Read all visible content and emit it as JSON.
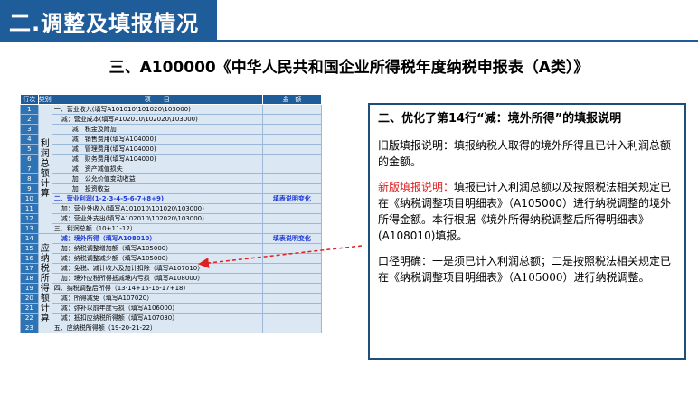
{
  "header": {
    "title": "二.调整及填报情况"
  },
  "main_title": "三、A100000《中华人民共和国企业所得税年度纳税申报表（A类）》",
  "table": {
    "headers": {
      "row": "行次",
      "category": "类别",
      "item": "项　　目",
      "amount": "金　额"
    },
    "category_profit": "利润总额计算",
    "category_taxable": "应纳税所得额计算",
    "rows": [
      {
        "num": "1",
        "item": "一、营业收入(填写A101010\\101020\\103000)",
        "amount": ""
      },
      {
        "num": "2",
        "item": "减：营业成本(填写A102010\\102020\\103000)",
        "amount": ""
      },
      {
        "num": "3",
        "item": "减：税金及附加",
        "amount": ""
      },
      {
        "num": "4",
        "item": "减：销售费用(填写A104000)",
        "amount": ""
      },
      {
        "num": "5",
        "item": "减：管理费用(填写A104000)",
        "amount": ""
      },
      {
        "num": "6",
        "item": "减：财务费用(填写A104000)",
        "amount": ""
      },
      {
        "num": "7",
        "item": "减：资产减值损失",
        "amount": ""
      },
      {
        "num": "8",
        "item": "加：公允价值变动收益",
        "amount": ""
      },
      {
        "num": "9",
        "item": "加：投资收益",
        "amount": ""
      },
      {
        "num": "10",
        "item": "二、营业利润(1-2-3-4-5-6-7+8+9)",
        "amount": "填表说明变化"
      },
      {
        "num": "11",
        "item": "加：营业外收入(填写A101010\\101020\\103000)",
        "amount": ""
      },
      {
        "num": "12",
        "item": "减：营业外支出(填写A102010\\102020\\103000)",
        "amount": ""
      },
      {
        "num": "13",
        "item": "三、利润总额（10+11-12）",
        "amount": ""
      },
      {
        "num": "14",
        "item": "减：境外所得（填写A108010）",
        "amount": "填表说明变化"
      },
      {
        "num": "15",
        "item": "加：纳税调整增加额（填写A105000）",
        "amount": ""
      },
      {
        "num": "16",
        "item": "减：纳税调整减少额（填写A105000）",
        "amount": ""
      },
      {
        "num": "17",
        "item": "减：免税、减计收入及加计扣除（填写A107010）",
        "amount": ""
      },
      {
        "num": "18",
        "item": "加：境外应税所得抵减境内亏损（填写A108000）",
        "amount": ""
      },
      {
        "num": "19",
        "item": "四、纳税调整后所得（13-14+15-16-17+18）",
        "amount": ""
      },
      {
        "num": "20",
        "item": "减：所得减免（填写A107020）",
        "amount": ""
      },
      {
        "num": "21",
        "item": "减：弥补以前年度亏损（填写A106000）",
        "amount": ""
      },
      {
        "num": "22",
        "item": "减：抵扣应纳税所得额（填写A107030）",
        "amount": ""
      },
      {
        "num": "23",
        "item": "五、应纳税所得额（19-20-21-22）",
        "amount": ""
      }
    ]
  },
  "info": {
    "heading": "二、优化了第14行“减：境外所得”的填报说明",
    "old_text": "旧版填报说明：填报纳税人取得的境外所得且已计入利润总额的金额。",
    "new_label": "新版填报说明：",
    "new_text": "填报已计入利润总额以及按照税法相关规定已在《纳税调整项目明细表》（A105000）进行纳税调整的境外所得金额。本行根据《境外所得纳税调整后所得明细表》(A108010)填报。",
    "oral_text": "口径明确：一是须已计入利润总额；二是按照税法相关规定已在《纳税调整项目明细表》（A105000）进行纳税调整。"
  }
}
